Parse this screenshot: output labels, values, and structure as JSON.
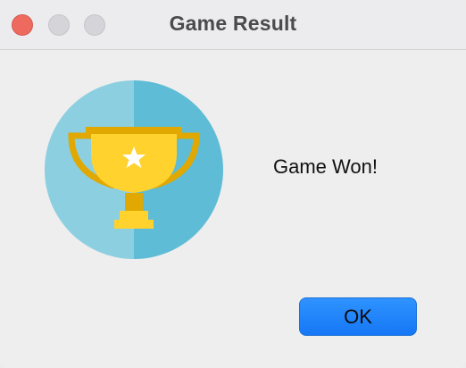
{
  "window": {
    "title": "Game Result"
  },
  "traffic_lights": [
    "close",
    "minimize",
    "maximize"
  ],
  "dialog": {
    "icon": "trophy-icon",
    "message": "Game Won!",
    "ok_label": "OK"
  },
  "colors": {
    "accent": "#1a7ef7",
    "close": "#ee6a5f",
    "trophy_gold": "#ffd22e",
    "circle_light": "#8ccfe0",
    "circle_dark": "#5fbcd6"
  }
}
